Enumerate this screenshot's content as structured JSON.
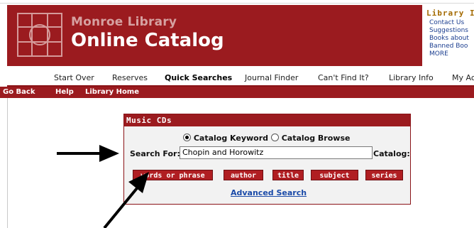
{
  "header": {
    "library_name": "Monroe Library",
    "catalog_title": "Online Catalog",
    "info_title": "Library I",
    "info_links": [
      "Contact Us",
      "Suggestions",
      "Books about",
      "Banned Boo",
      "MORE"
    ]
  },
  "nav": {
    "items": [
      "Start Over",
      "Reserves",
      "Quick Searches",
      "Journal Finder",
      "Can't Find It?",
      "Library Info",
      "My Ac"
    ],
    "active": "Quick Searches"
  },
  "subnav": {
    "items": [
      "Go Back",
      "Help",
      "Library Home"
    ]
  },
  "search_panel": {
    "title": "Music CDs",
    "radio_options": [
      {
        "label": "Catalog Keyword",
        "selected": true
      },
      {
        "label": "Catalog Browse",
        "selected": false
      }
    ],
    "search_label": "Search For:",
    "search_value": "Chopin and Horowitz",
    "catalog_label": "Catalog:",
    "buttons": [
      "words or phrase",
      "author",
      "title",
      "subject",
      "series"
    ],
    "advanced_link": "Advanced Search"
  },
  "colors": {
    "brand": "#9b1b1f",
    "button": "#b01e22",
    "link": "#1a4aa8",
    "info_title": "#a36a00"
  }
}
